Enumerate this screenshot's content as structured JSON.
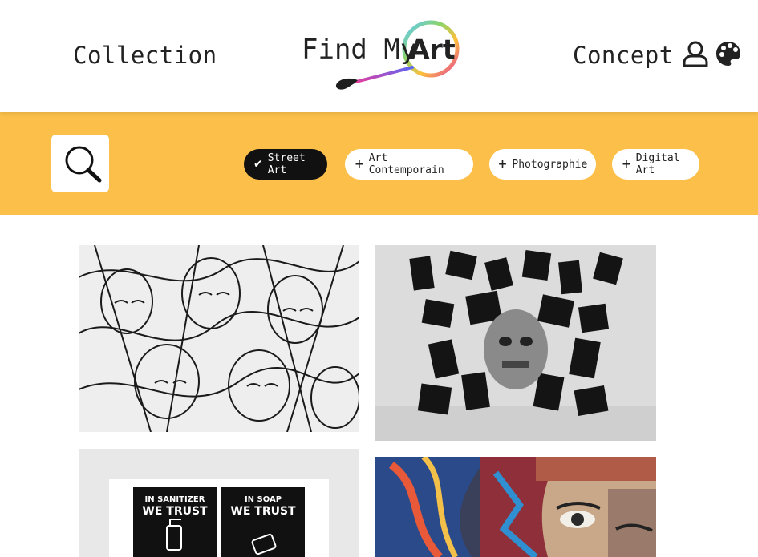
{
  "header": {
    "nav_left": "Collection",
    "nav_right": "Concept",
    "logo": {
      "text": "Find My",
      "highlight": "Art"
    },
    "icons": [
      "user-icon",
      "palette-icon"
    ]
  },
  "filters": {
    "search_icon": "search-icon",
    "chips": [
      {
        "label": "Street Art",
        "state": "selected",
        "icon": "check-icon"
      },
      {
        "label": "Art Contemporain",
        "state": "unselected",
        "icon": "plus-icon"
      },
      {
        "label": "Photographie",
        "state": "unselected",
        "icon": "plus-icon"
      },
      {
        "label": "Digital Art",
        "state": "unselected",
        "icon": "plus-icon"
      }
    ]
  },
  "gallery": {
    "poster_lines": [
      "IN SANITIZER",
      "WE TRUST",
      "IN SOAP",
      "WE TRUST"
    ]
  },
  "colors": {
    "accent": "#fcc04a",
    "chip_active_bg": "#111111",
    "chip_bg": "#ffffff",
    "text": "#222222"
  }
}
